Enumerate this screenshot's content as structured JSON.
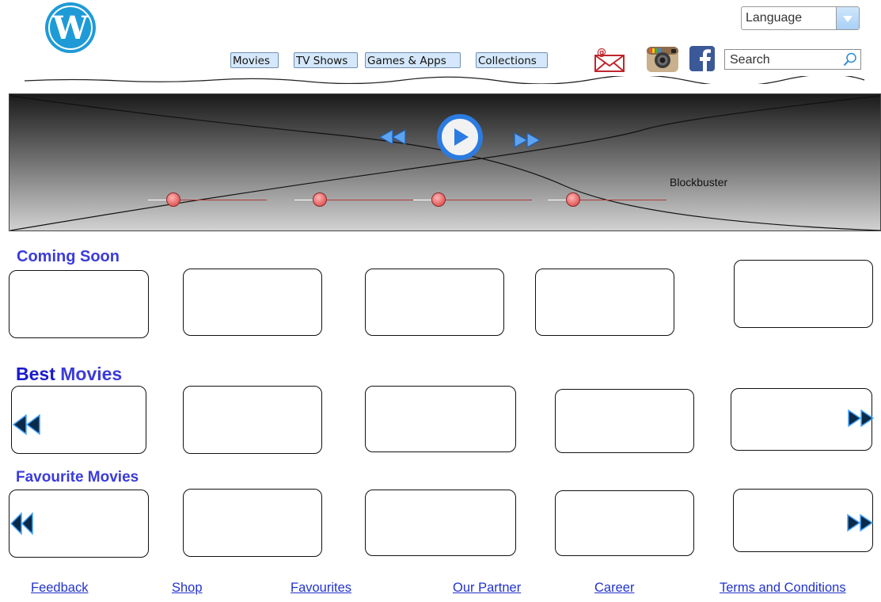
{
  "header": {
    "logo": "wordpress-logo",
    "language": {
      "value": "Language"
    },
    "nav": [
      "Movies",
      "TV Shows",
      "Games & Apps",
      "Collections"
    ],
    "social_icons": [
      "mail-icon",
      "instagram-icon",
      "facebook-icon"
    ],
    "search": {
      "placeholder": "Search"
    }
  },
  "hero": {
    "label": "Blockbuster",
    "controls": [
      "rewind-icon",
      "play-icon",
      "fast-forward-icon"
    ],
    "slider_count": 4
  },
  "sections": [
    {
      "title": "Coming Soon",
      "cards": 5
    },
    {
      "title_part1": "Best",
      "title_part2": "Movies",
      "cards": 5
    },
    {
      "title": "Favourite Movies",
      "cards": 5
    }
  ],
  "footer": {
    "links": [
      "Feedback",
      "Shop",
      "Favourites",
      "Our Partner",
      "Career",
      "Terms and Conditions"
    ]
  },
  "colors": {
    "accent": "#3b3bdc",
    "link": "#2233cc",
    "play": "#2b7be0",
    "nav_bg": "#d5e8fb"
  }
}
